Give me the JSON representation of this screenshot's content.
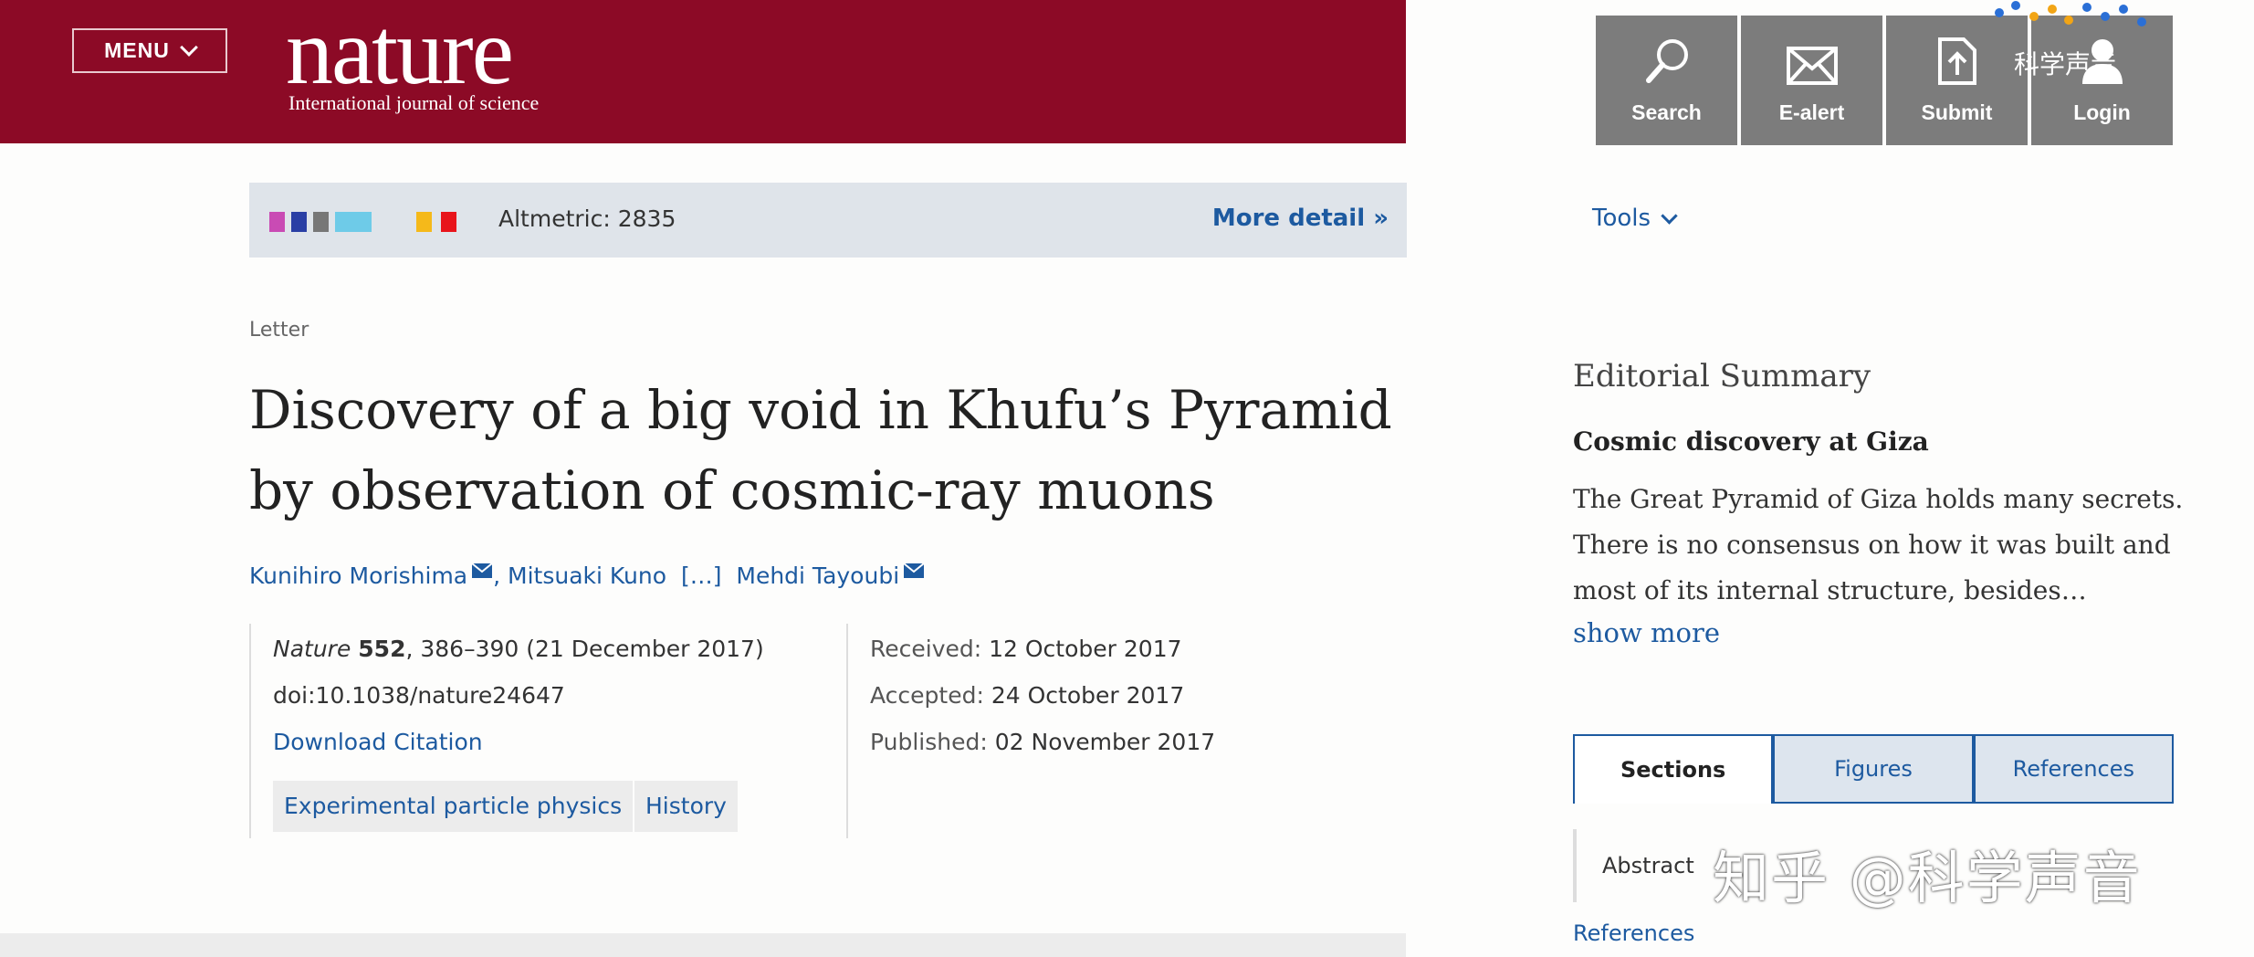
{
  "header": {
    "menu_label": "MENU",
    "logo": "nature",
    "tagline": "International journal of science"
  },
  "actions": [
    {
      "label": "Search",
      "icon": "search-icon"
    },
    {
      "label": "E-alert",
      "icon": "mail-icon"
    },
    {
      "label": "Submit",
      "icon": "upload-icon"
    },
    {
      "label": "Login",
      "icon": "user-icon"
    }
  ],
  "top_watermark": "科学声音",
  "altmetric": {
    "label": "Altmetric: 2835",
    "more_detail": "More detail",
    "colors": [
      "#c94bb4",
      "#2a3fa5",
      "#777777",
      "#6ecbe8",
      "#f5b91a",
      "#e8141b"
    ]
  },
  "article": {
    "type": "Letter",
    "title_line1": "Discovery of a big void in Khufu’s Pyramid",
    "title_line2": "by observation of cosmic-ray muons",
    "authors": [
      "Kunihiro Morishima",
      "Mitsuaki Kuno",
      "[…]",
      "Mehdi Tayoubi"
    ],
    "journal_name": "Nature",
    "journal_volume": "552",
    "journal_rest": ", 386–390 (21 December 2017)",
    "doi": "doi:10.1038/nature24647",
    "download_citation": "Download Citation",
    "tags": [
      "Experimental particle physics",
      "History"
    ],
    "received_label": "Received:",
    "received": "12 October 2017",
    "accepted_label": "Accepted:",
    "accepted": "24 October 2017",
    "published_label": "Published:",
    "published": "02 November 2017"
  },
  "sidebar": {
    "tools": "Tools",
    "editorial_heading": "Editorial Summary",
    "editorial_subheading": "Cosmic discovery at Giza",
    "editorial_body": "The Great Pyramid of Giza holds many secrets. There is no consensus on how it was built and most of its internal structure, besides…",
    "show_more": "show more",
    "tabs": [
      "Sections",
      "Figures",
      "References"
    ],
    "toc_abstract": "Abstract",
    "toc_references": "References"
  },
  "watermark": "知乎 @科学声音"
}
